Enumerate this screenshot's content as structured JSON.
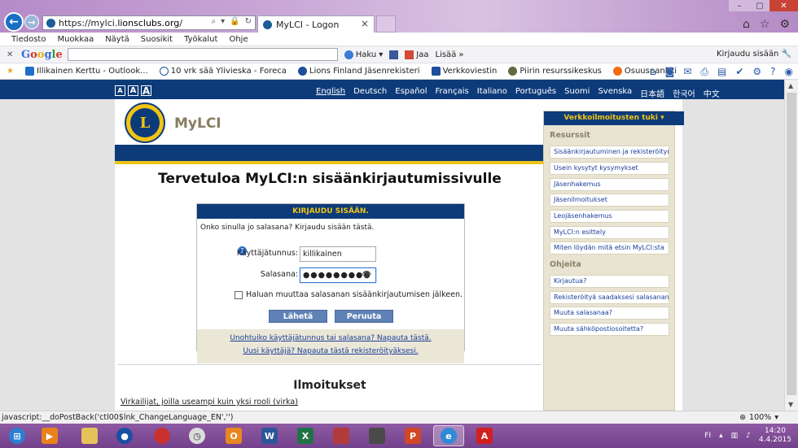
{
  "browser": {
    "url_prefix": "https://mylci.",
    "url_domain": "lionsclubs.org",
    "url_suffix": "/",
    "tab_title": "MyLCI - Logon",
    "menu": [
      "Tiedosto",
      "Muokkaa",
      "Näytä",
      "Suosikit",
      "Työkalut",
      "Ohje"
    ],
    "google": {
      "search_btn": "Haku",
      "share_btn": "Jaa",
      "more_btn": "Lisää",
      "signin": "Kirjaudu sisään"
    },
    "favorites": [
      "Illikainen Kerttu - Outlook...",
      "10 vrk sää Ylivieska - Foreca",
      "Lions Finland Jäsenrekisteri",
      "Verkkoviestin",
      "Piirin resurssikeskus",
      "Osuuspankki"
    ]
  },
  "site": {
    "text_sizes": [
      "A",
      "A",
      "A"
    ],
    "languages": [
      "English",
      "Deutsch",
      "Español",
      "Français",
      "Italiano",
      "Português",
      "Suomi",
      "Svenska",
      "日本語",
      "한국어",
      "中文"
    ],
    "brand": "MyLCI",
    "logo_letter": "L"
  },
  "login": {
    "welcome": "Tervetuloa MyLCI:n sisäänkirjautumissivulle",
    "box_title": "KIRJAUDU SISÄÄN.",
    "intro": "Onko sinulla jo salasana? Kirjaudu sisään tästä.",
    "username_label": "Käyttäjätunnus:",
    "username_value": "killikainen",
    "password_label": "Salasana:",
    "password_value": "●●●●●●●●●",
    "change_password_label": "Haluan muuttaa salasanan sisäänkirjautumisen jälkeen.",
    "submit_label": "Lähetä",
    "cancel_label": "Peruuta",
    "forgot_link": "Unohtuiko käyttäjätunnus tai salasana? Napauta tästä.",
    "new_user_link": "Uusi käyttäjä? Napauta tästä rekisteröityäksesi."
  },
  "notices": {
    "title": "Ilmoitukset",
    "link": "Virkailijat, joilla useampi kuin yksi rooli (virka)"
  },
  "sidebar": {
    "title": "Verkkoilmoitusten tuki",
    "resources_title": "Resurssit",
    "resources": [
      "Sisäänkirjautuminen ja rekisteröityminen",
      "Usein kysytyt kysymykset",
      "Jäsenhakemus",
      "Jäsenilmoitukset",
      "Leojäsenhakemus",
      "MyLCI:n esittely",
      "Miten löydän mitä etsin MyLCI:sta"
    ],
    "help_title": "Ohjeita",
    "help": [
      "Kirjautua?",
      "Rekisteröityä saadaksesi salasanan?",
      "Muuta salasanaa?",
      "Muuta sähköpostiosoitetta?"
    ]
  },
  "status": {
    "text": "javascript:__doPostBack('ctl00$lnk_ChangeLanguage_EN','')",
    "zoom": "100%"
  },
  "taskbar": {
    "lang": "FI",
    "time": "14:20",
    "date": "4.4.2015"
  },
  "colors": {
    "navy": "#0d3b7a",
    "gold": "#f1c414",
    "button": "#5f82b6",
    "sidebar_bg": "#e9e4d2"
  }
}
